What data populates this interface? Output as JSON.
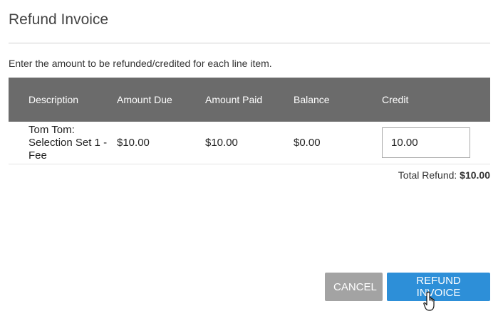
{
  "dialog": {
    "title": "Refund Invoice",
    "instructions": "Enter the amount to be refunded/credited for each line item."
  },
  "table": {
    "headers": {
      "description": "Description",
      "amount_due": "Amount Due",
      "amount_paid": "Amount Paid",
      "balance": "Balance",
      "credit": "Credit"
    },
    "rows": [
      {
        "description": "Tom Tom:\nSelection Set 1 -\nFee",
        "amount_due": "$10.00",
        "amount_paid": "$10.00",
        "balance": "$0.00",
        "credit": "10.00"
      }
    ]
  },
  "total": {
    "label": "Total Refund:",
    "amount": "$10.00"
  },
  "buttons": {
    "cancel": "CANCEL",
    "refund": "REFUND INVOICE"
  },
  "colors": {
    "header_bg": "#6b6b6b",
    "cancel_bg": "#a3a3a3",
    "primary_bg": "#2d8fd8"
  },
  "icons": {
    "cursor": "hand-pointer-icon"
  }
}
